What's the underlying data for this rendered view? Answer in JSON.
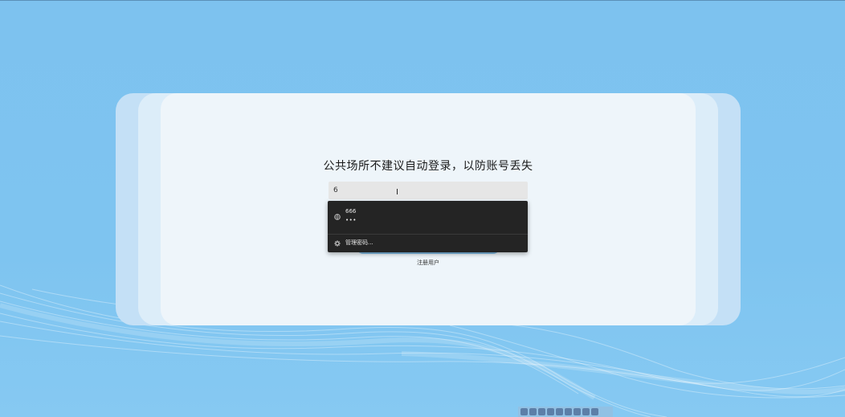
{
  "colors": {
    "background": "#7ec4f0",
    "card": "#eef5fa",
    "dropdown": "#242424",
    "accent": "#7fbde8"
  },
  "login": {
    "title": "公共场所不建议自动登录，以防账号丢失",
    "username_value": "6",
    "register_label": "注册用户"
  },
  "autofill": {
    "items": [
      {
        "icon": "key-globe-icon",
        "username": "666",
        "password_mask": "•••"
      }
    ],
    "manage_label": "管理密码...",
    "manage_icon": "gear-icon"
  },
  "taskbar": {
    "icons": [
      "keyboard-icon",
      "chinese-input-icon",
      "moon-icon",
      "punctuation-icon",
      "grid-icon",
      "keyboard-layout-icon",
      "clipboard-icon",
      "shirt-icon",
      "settings-icon"
    ]
  }
}
